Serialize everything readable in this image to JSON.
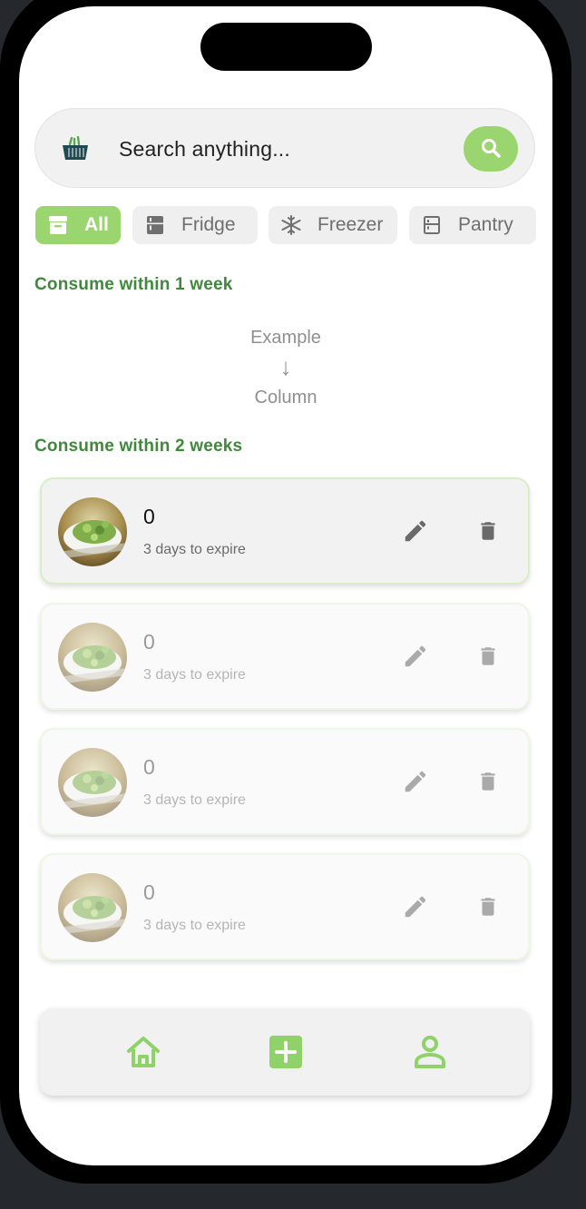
{
  "search": {
    "placeholder": "Search anything..."
  },
  "filters": [
    {
      "label": "All",
      "icon": "archive-icon",
      "active": true
    },
    {
      "label": "Fridge",
      "icon": "fridge-icon",
      "active": false
    },
    {
      "label": "Freezer",
      "icon": "snowflake-icon",
      "active": false
    },
    {
      "label": "Pantry",
      "icon": "cabinet-icon",
      "active": false
    }
  ],
  "sections": {
    "week1": {
      "title": "Consume within 1 week"
    },
    "example": {
      "line1": "Example",
      "arrow": "↓",
      "line2": "Column"
    },
    "week2": {
      "title": "Consume within 2 weeks"
    }
  },
  "items": [
    {
      "quantity": "0",
      "expiry": "3 days to expire"
    },
    {
      "quantity": "0",
      "expiry": "3 days to expire"
    },
    {
      "quantity": "0",
      "expiry": "3 days to expire"
    },
    {
      "quantity": "0",
      "expiry": "3 days to expire"
    }
  ],
  "nav": {
    "home": "home-icon",
    "add": "add-icon",
    "profile": "profile-icon"
  },
  "colors": {
    "accent": "#9bd56f",
    "section_title": "#3e8a3a",
    "bezel": "#000000",
    "backdrop": "#25282c"
  }
}
